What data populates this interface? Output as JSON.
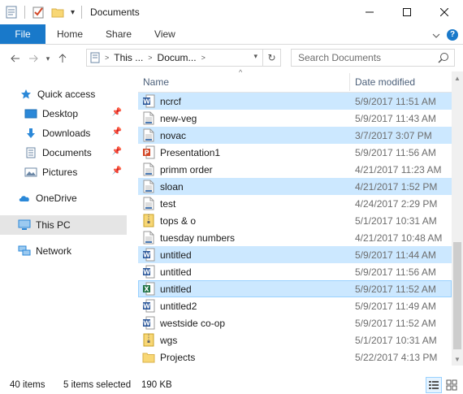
{
  "window": {
    "title": "Documents"
  },
  "ribbon": {
    "tabs": [
      {
        "label": "File"
      },
      {
        "label": "Home"
      },
      {
        "label": "Share"
      },
      {
        "label": "View"
      }
    ],
    "help": "?"
  },
  "address": {
    "crumbs": [
      "This ...",
      "Docum..."
    ],
    "search_placeholder": "Search Documents"
  },
  "nav": {
    "items": [
      {
        "label": "Quick access",
        "icon": "star-icon"
      },
      {
        "label": "Desktop",
        "icon": "desktop-icon",
        "pinned": true
      },
      {
        "label": "Downloads",
        "icon": "download-icon",
        "pinned": true
      },
      {
        "label": "Documents",
        "icon": "document-icon",
        "pinned": true
      },
      {
        "label": "Pictures",
        "icon": "pictures-icon",
        "pinned": true
      },
      {
        "label": "OneDrive",
        "icon": "cloud-icon"
      },
      {
        "label": "This PC",
        "icon": "computer-icon",
        "selected": true
      },
      {
        "label": "Network",
        "icon": "network-icon"
      }
    ]
  },
  "columns": {
    "name": "Name",
    "date": "Date modified"
  },
  "files": [
    {
      "name": "ncrcf",
      "date": "5/9/2017 11:51 AM",
      "type": "word",
      "selected": true
    },
    {
      "name": "new-veg",
      "date": "5/9/2017 11:43 AM",
      "type": "generic"
    },
    {
      "name": "novac",
      "date": "3/7/2017 3:07 PM",
      "type": "generic",
      "selected": true
    },
    {
      "name": "Presentation1",
      "date": "5/9/2017 11:56 AM",
      "type": "powerpoint"
    },
    {
      "name": "primm order",
      "date": "4/21/2017 11:23 AM",
      "type": "generic"
    },
    {
      "name": "sloan",
      "date": "4/21/2017 1:52 PM",
      "type": "generic",
      "selected": true
    },
    {
      "name": "test",
      "date": "4/24/2017 2:29 PM",
      "type": "generic"
    },
    {
      "name": "tops & o",
      "date": "5/1/2017 10:31 AM",
      "type": "zip"
    },
    {
      "name": "tuesday numbers",
      "date": "4/21/2017 10:48 AM",
      "type": "generic"
    },
    {
      "name": "untitled",
      "date": "5/9/2017 11:44 AM",
      "type": "word",
      "selected": true
    },
    {
      "name": "untitled",
      "date": "5/9/2017 11:56 AM",
      "type": "word"
    },
    {
      "name": "untitled",
      "date": "5/9/2017 11:52 AM",
      "type": "excel",
      "selected": true,
      "focused": true
    },
    {
      "name": "untitled2",
      "date": "5/9/2017 11:49 AM",
      "type": "word"
    },
    {
      "name": "westside co-op",
      "date": "5/9/2017 11:52 AM",
      "type": "word"
    },
    {
      "name": "wgs",
      "date": "5/1/2017 10:31 AM",
      "type": "zip"
    },
    {
      "name": "Projects",
      "date": "5/22/2017 4:13 PM",
      "type": "folder"
    }
  ],
  "status": {
    "count": "40 items",
    "selection": "5 items selected",
    "size": "190 KB"
  },
  "colors": {
    "accent": "#1979ca",
    "selection": "#cce8ff",
    "word": "#2b579a",
    "excel": "#217346",
    "powerpoint": "#d24726",
    "folder": "#f8d775"
  }
}
